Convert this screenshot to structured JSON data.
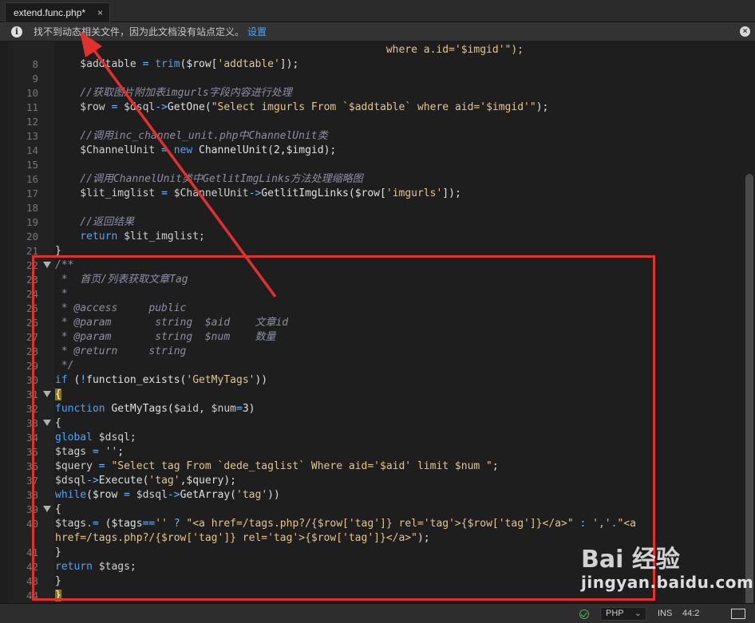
{
  "tab": {
    "title": "extend.func.php*",
    "close": "×"
  },
  "infobar": {
    "message": "找不到动态相关文件，因为此文档没有站点定义。",
    "link": "设置",
    "info_icon": "i",
    "close_icon": "×"
  },
  "lines": [
    {
      "n": "",
      "spans": [
        {
          "c": "c-str",
          "t": "                                                     where a.id='$imgid'\");"
        }
      ]
    },
    {
      "n": "8",
      "spans": [
        {
          "c": "c-var",
          "t": "    $addtable "
        },
        {
          "c": "c-op",
          "t": "="
        },
        {
          "c": "c-kw",
          "t": " trim"
        },
        {
          "c": "c-br",
          "t": "($row["
        },
        {
          "c": "c-str",
          "t": "'addtable'"
        },
        {
          "c": "c-br",
          "t": "]);"
        }
      ]
    },
    {
      "n": "9",
      "spans": []
    },
    {
      "n": "10",
      "spans": [
        {
          "c": "c-cm",
          "t": "    //获取图片附加表imgurls字段内容进行处理"
        }
      ]
    },
    {
      "n": "11",
      "spans": [
        {
          "c": "c-var",
          "t": "    $row "
        },
        {
          "c": "c-op",
          "t": "="
        },
        {
          "c": "c-var",
          "t": " $dsql"
        },
        {
          "c": "c-op",
          "t": "->"
        },
        {
          "c": "c-br",
          "t": "GetOne("
        },
        {
          "c": "c-str",
          "t": "\"Select imgurls From `$addtable` where aid='$imgid'\""
        },
        {
          "c": "c-br",
          "t": ");"
        }
      ]
    },
    {
      "n": "12",
      "spans": []
    },
    {
      "n": "13",
      "spans": [
        {
          "c": "c-cm",
          "t": "    //调用inc_channel_unit.php中ChannelUnit类"
        }
      ]
    },
    {
      "n": "14",
      "spans": [
        {
          "c": "c-var",
          "t": "    $ChannelUnit "
        },
        {
          "c": "c-op",
          "t": "="
        },
        {
          "c": "c-kw",
          "t": " new"
        },
        {
          "c": "c-br",
          "t": " ChannelUnit(2,$imgid);"
        }
      ]
    },
    {
      "n": "15",
      "spans": []
    },
    {
      "n": "16",
      "spans": [
        {
          "c": "c-cm",
          "t": "    //调用ChannelUnit类中GetlitImgLinks方法处理缩略图"
        }
      ]
    },
    {
      "n": "17",
      "spans": [
        {
          "c": "c-var",
          "t": "    $lit_imglist "
        },
        {
          "c": "c-op",
          "t": "="
        },
        {
          "c": "c-var",
          "t": " $ChannelUnit"
        },
        {
          "c": "c-op",
          "t": "->"
        },
        {
          "c": "c-br",
          "t": "GetlitImgLinks($row["
        },
        {
          "c": "c-str",
          "t": "'imgurls'"
        },
        {
          "c": "c-br",
          "t": "]);"
        }
      ]
    },
    {
      "n": "18",
      "spans": []
    },
    {
      "n": "19",
      "spans": [
        {
          "c": "c-cm",
          "t": "    //返回结果"
        }
      ]
    },
    {
      "n": "20",
      "spans": [
        {
          "c": "c-kw",
          "t": "    return"
        },
        {
          "c": "c-var",
          "t": " $lit_imglist;"
        }
      ]
    },
    {
      "n": "21",
      "spans": [
        {
          "c": "c-br",
          "t": "}"
        }
      ]
    },
    {
      "n": "22",
      "fold": true,
      "spans": [
        {
          "c": "c-cm",
          "t": "/**"
        }
      ]
    },
    {
      "n": "23",
      "spans": [
        {
          "c": "c-cm",
          "t": " *  首页/列表获取文章Tag"
        }
      ]
    },
    {
      "n": "24",
      "spans": [
        {
          "c": "c-cm",
          "t": " *"
        }
      ]
    },
    {
      "n": "25",
      "spans": [
        {
          "c": "c-cm",
          "t": " * @access     public"
        }
      ]
    },
    {
      "n": "26",
      "spans": [
        {
          "c": "c-cm",
          "t": " * @param       string  $aid    文章id"
        }
      ]
    },
    {
      "n": "27",
      "spans": [
        {
          "c": "c-cm",
          "t": " * @param       string  $num    数量"
        }
      ]
    },
    {
      "n": "28",
      "spans": [
        {
          "c": "c-cm",
          "t": " * @return     string"
        }
      ]
    },
    {
      "n": "29",
      "spans": [
        {
          "c": "c-cm",
          "t": " */"
        }
      ]
    },
    {
      "n": "30",
      "spans": [
        {
          "c": "c-kw",
          "t": "if"
        },
        {
          "c": "c-br",
          "t": " ("
        },
        {
          "c": "c-op",
          "t": "!"
        },
        {
          "c": "c-br",
          "t": "function_exists("
        },
        {
          "c": "c-str",
          "t": "'GetMyTags'"
        },
        {
          "c": "c-br",
          "t": "))"
        }
      ]
    },
    {
      "n": "31",
      "fold": true,
      "spans": [
        {
          "c": "brace-hl",
          "t": "{"
        }
      ]
    },
    {
      "n": "32",
      "spans": [
        {
          "c": "c-kw",
          "t": "function"
        },
        {
          "c": "c-br",
          "t": " GetMyTags("
        },
        {
          "c": "c-var",
          "t": "$aid, $num"
        },
        {
          "c": "c-op",
          "t": "="
        },
        {
          "c": "c-br",
          "t": "3)"
        }
      ]
    },
    {
      "n": "33",
      "fold": true,
      "spans": [
        {
          "c": "c-br",
          "t": "{"
        }
      ]
    },
    {
      "n": "34",
      "spans": [
        {
          "c": "c-kw",
          "t": "global"
        },
        {
          "c": "c-var",
          "t": " $dsql;"
        }
      ]
    },
    {
      "n": "35",
      "spans": [
        {
          "c": "c-var",
          "t": "$tags "
        },
        {
          "c": "c-op",
          "t": "="
        },
        {
          "c": "c-str",
          "t": " ''"
        },
        {
          "c": "c-br",
          "t": ";"
        }
      ]
    },
    {
      "n": "36",
      "spans": [
        {
          "c": "c-var",
          "t": "$query "
        },
        {
          "c": "c-op",
          "t": "="
        },
        {
          "c": "c-str",
          "t": " \"Select tag From `dede_taglist` Where aid='$aid' limit $num \""
        },
        {
          "c": "c-br",
          "t": ";"
        }
      ]
    },
    {
      "n": "37",
      "spans": [
        {
          "c": "c-var",
          "t": "$dsql"
        },
        {
          "c": "c-op",
          "t": "->"
        },
        {
          "c": "c-br",
          "t": "Execute("
        },
        {
          "c": "c-str",
          "t": "'tag'"
        },
        {
          "c": "c-br",
          "t": ",$query);"
        }
      ]
    },
    {
      "n": "38",
      "spans": [
        {
          "c": "c-kw",
          "t": "while"
        },
        {
          "c": "c-br",
          "t": "($row "
        },
        {
          "c": "c-op",
          "t": "="
        },
        {
          "c": "c-var",
          "t": " $dsql"
        },
        {
          "c": "c-op",
          "t": "->"
        },
        {
          "c": "c-br",
          "t": "GetArray("
        },
        {
          "c": "c-str",
          "t": "'tag'"
        },
        {
          "c": "c-br",
          "t": "))"
        }
      ]
    },
    {
      "n": "39",
      "fold": true,
      "spans": [
        {
          "c": "c-br",
          "t": "{"
        }
      ]
    },
    {
      "n": "40",
      "spans": [
        {
          "c": "c-var",
          "t": "$tags"
        },
        {
          "c": "c-op",
          "t": "."
        },
        {
          "c": "c-op",
          "t": "="
        },
        {
          "c": "c-br",
          "t": " ($tags"
        },
        {
          "c": "c-op",
          "t": "=="
        },
        {
          "c": "c-str",
          "t": "''"
        },
        {
          "c": "c-op",
          "t": " ?"
        },
        {
          "c": "c-str",
          "t": " \"<a href=/tags.php?/{$row['tag']} rel='tag'>{$row['tag']}</a>\""
        },
        {
          "c": "c-op",
          "t": " :"
        },
        {
          "c": "c-str",
          "t": " ','"
        },
        {
          "c": "c-op",
          "t": "."
        },
        {
          "c": "c-str",
          "t": "\"<a"
        }
      ]
    },
    {
      "n": "",
      "spans": [
        {
          "c": "c-str",
          "t": "href=/tags.php?/{$row['tag']} rel='tag'>{$row['tag']}</a>\""
        },
        {
          "c": "c-br",
          "t": ");"
        }
      ]
    },
    {
      "n": "41",
      "spans": [
        {
          "c": "c-br",
          "t": "}"
        }
      ]
    },
    {
      "n": "42",
      "spans": [
        {
          "c": "c-kw",
          "t": "return"
        },
        {
          "c": "c-var",
          "t": " $tags;"
        }
      ]
    },
    {
      "n": "43",
      "spans": [
        {
          "c": "c-br",
          "t": "}"
        }
      ]
    },
    {
      "n": "44",
      "spans": [
        {
          "c": "brace-hl",
          "t": "}"
        }
      ]
    }
  ],
  "status": {
    "language": "PHP",
    "mode": "INS",
    "position": "44:2"
  },
  "watermark": {
    "logo": "Bai 经验",
    "sub": "jingyan.baidu.com"
  },
  "annotation_color": "#e0312f"
}
